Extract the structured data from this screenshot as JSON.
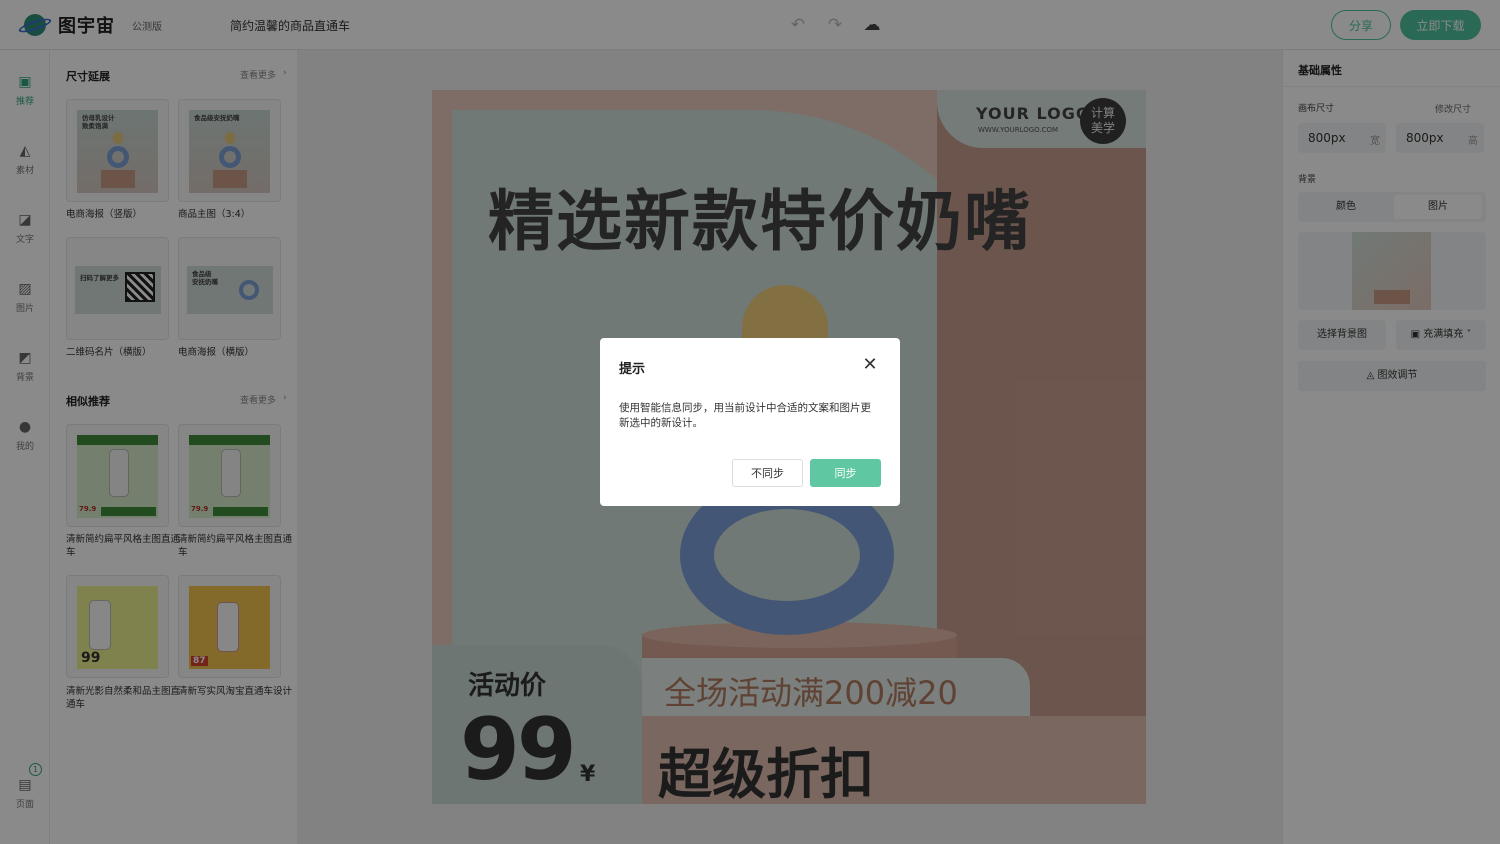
{
  "header": {
    "logo_text": "图宇宙",
    "beta": "公测版",
    "doc_title": "简约温馨的商品直通车",
    "share_label": "分享",
    "download_label": "立即下载"
  },
  "rail": {
    "items": [
      {
        "label": "推荐",
        "icon": "star-box-icon"
      },
      {
        "label": "素材",
        "icon": "shapes-icon"
      },
      {
        "label": "文字",
        "icon": "text-icon"
      },
      {
        "label": "图片",
        "icon": "image-icon"
      },
      {
        "label": "背景",
        "icon": "background-icon"
      },
      {
        "label": "我的",
        "icon": "user-icon"
      }
    ],
    "pages_label": "页面",
    "pages_count": "1"
  },
  "left_panel": {
    "section1_title": "尺寸延展",
    "section1_more": "查看更多",
    "section1_items": [
      {
        "label": "电商海报（竖版）",
        "thumb_text": "仿母乳设计\n致柔饱满"
      },
      {
        "label": "商品主图（3:4）",
        "thumb_text": "食品级安抚奶嘴"
      },
      {
        "label": "二维码名片（横版）",
        "thumb_text": "扫码了解更多"
      },
      {
        "label": "电商海报（横版）",
        "thumb_text": "食品级\n安抚奶嘴"
      }
    ],
    "section2_title": "相似推荐",
    "section2_more": "查看更多",
    "section2_items": [
      {
        "label": "清新简约扁平风格主图直通车",
        "thumb_price": "79.9"
      },
      {
        "label": "清新简约扁平风格主图直通车",
        "thumb_price": "79.9"
      },
      {
        "label": "清新光影自然柔和品主图直通车",
        "thumb_price": "99"
      },
      {
        "label": "清新写实风淘宝直通车设计",
        "thumb_price": "87"
      }
    ]
  },
  "canvas": {
    "logo": "YOUR LOGO",
    "logo_url": "WWW.YOURLOGO.COM",
    "badge": "计算\n美学",
    "headline": "精选新款特价奶嘴",
    "price_label": "活动价",
    "price": "99",
    "currency": "¥",
    "promo": "全场活动满200减20",
    "sale": "超级折扣"
  },
  "right_panel": {
    "title": "基础属性",
    "canvas_size_label": "画布尺寸",
    "resize_link": "修改尺寸",
    "width_value": "800px",
    "width_unit": "宽",
    "height_value": "800px",
    "height_unit": "高",
    "background_label": "背景",
    "tab_color": "颜色",
    "tab_image": "图片",
    "choose_bg": "选择背景图",
    "fill_mode": "充满填充",
    "effects": "图效调节"
  },
  "dialog": {
    "title": "提示",
    "body": "使用智能信息同步，用当前设计中合适的文案和图片更新选中的新设计。",
    "cancel_label": "不同步",
    "ok_label": "同步"
  },
  "colors": {
    "accent": "#4fc39e",
    "overlay": "rgba(0,0,0,0.46)"
  }
}
